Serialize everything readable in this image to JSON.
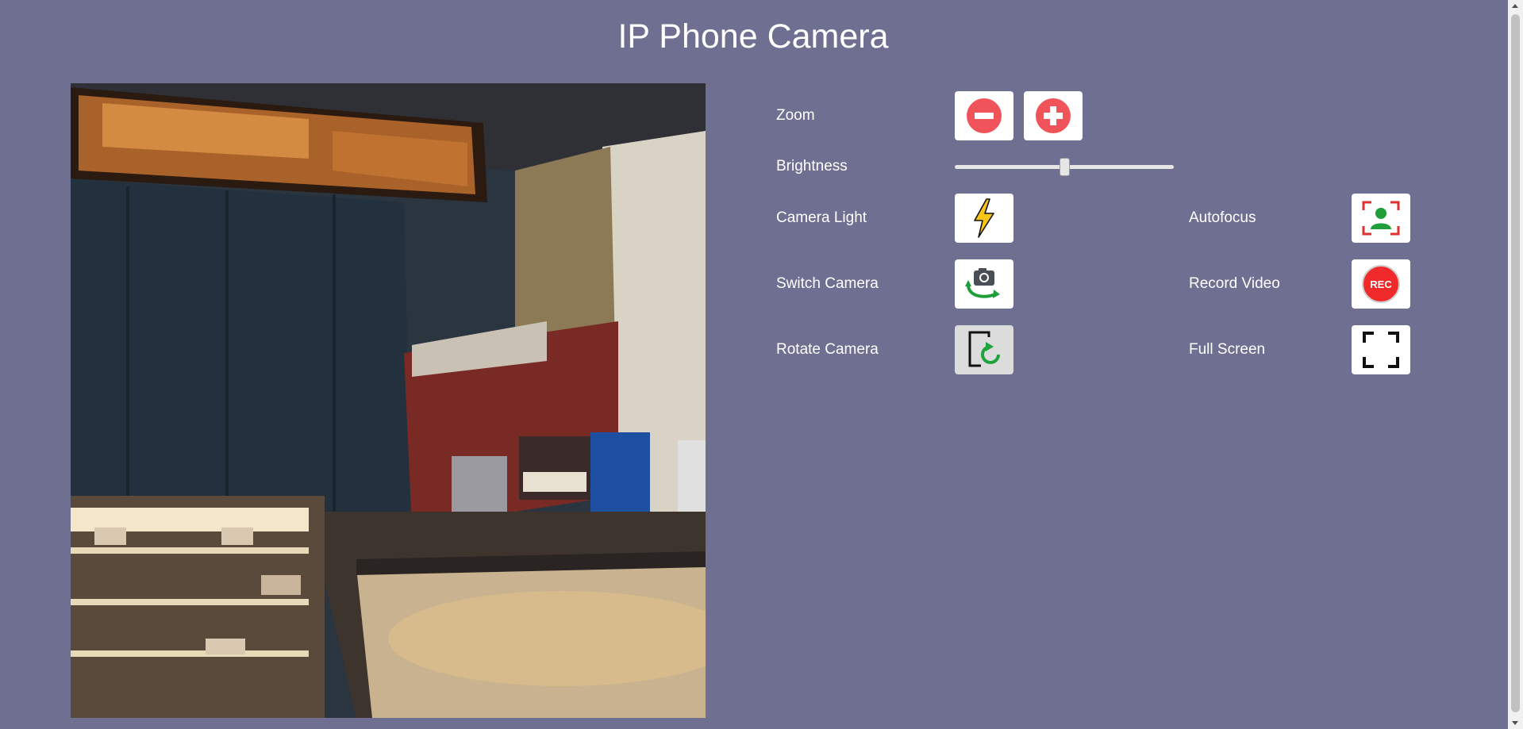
{
  "title": "IP Phone Camera",
  "controls": {
    "zoom_label": "Zoom",
    "brightness_label": "Brightness",
    "brightness_level": 0.5,
    "camera_light_label": "Camera Light",
    "autofocus_label": "Autofocus",
    "switch_camera_label": "Switch Camera",
    "record_video_label": "Record Video",
    "record_badge": "REC",
    "rotate_camera_label": "Rotate Camera",
    "full_screen_label": "Full Screen"
  },
  "colors": {
    "background": "#6e6f91",
    "zoom_icon": "#f0535a",
    "lightning": "#f5c518",
    "autofocus_person": "#1f9e3a",
    "autofocus_frame": "#e23030",
    "record": "#f02a2a",
    "rotate_arrow": "#1fa33d"
  },
  "icons": {
    "zoom_out": "minus-circle-icon",
    "zoom_in": "plus-circle-icon",
    "camera_light": "lightning-icon",
    "autofocus": "focus-person-icon",
    "switch_camera": "camera-switch-icon",
    "record_video": "record-icon",
    "rotate_camera": "rotate-icon",
    "full_screen": "fullscreen-icon"
  }
}
